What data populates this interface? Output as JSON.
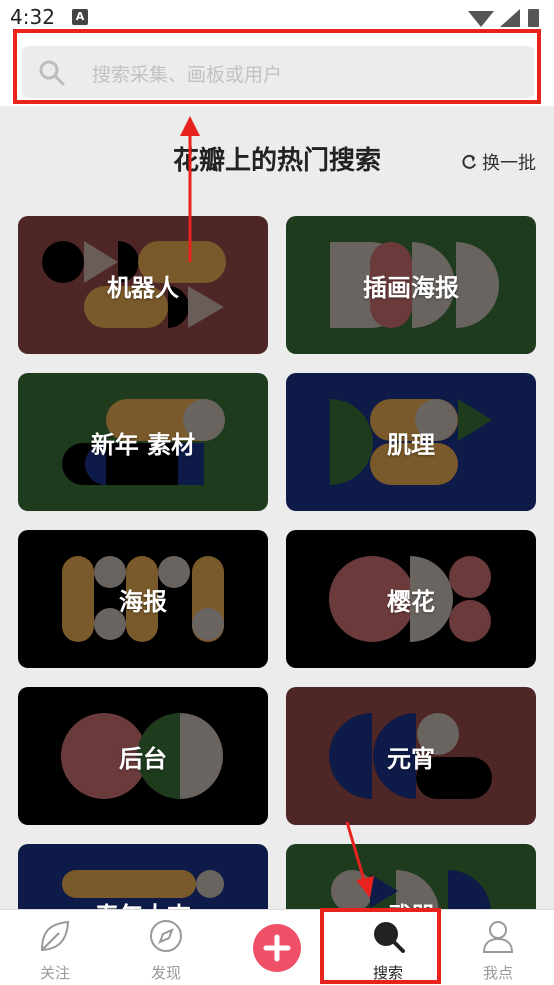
{
  "status_bar": {
    "time": "4:32",
    "notification_glyph": "A"
  },
  "search": {
    "placeholder": "搜索采集、画板或用户",
    "icon": "search-icon"
  },
  "hot": {
    "title": "花瓣上的热门搜索",
    "refresh_label": "换一批",
    "cards": [
      {
        "label": "机器人",
        "bg": "#4f2626"
      },
      {
        "label": "插画海报",
        "bg": "#1e3b1e"
      },
      {
        "label": "新年 素材",
        "bg": "#1e3b1e"
      },
      {
        "label": "肌理",
        "bg": "#0e1a48"
      },
      {
        "label": "海报",
        "bg": "#000000"
      },
      {
        "label": "樱花",
        "bg": "#000000"
      },
      {
        "label": "后台",
        "bg": "#000000"
      },
      {
        "label": "元宵",
        "bg": "#4f2626"
      },
      {
        "label": "春年大吉",
        "bg": "#0e1a48"
      },
      {
        "label": "武器",
        "bg": "#1e3b1e"
      }
    ]
  },
  "tabbar": {
    "tabs": [
      {
        "label": "关注",
        "icon": "leaf-icon"
      },
      {
        "label": "发现",
        "icon": "compass-icon"
      },
      {
        "label": "",
        "icon": "plus-icon"
      },
      {
        "label": "搜索",
        "icon": "search-icon",
        "active": true
      },
      {
        "label": "我点",
        "icon": "user-icon"
      }
    ]
  },
  "annotations": {
    "highlight_color": "#e8231d"
  }
}
